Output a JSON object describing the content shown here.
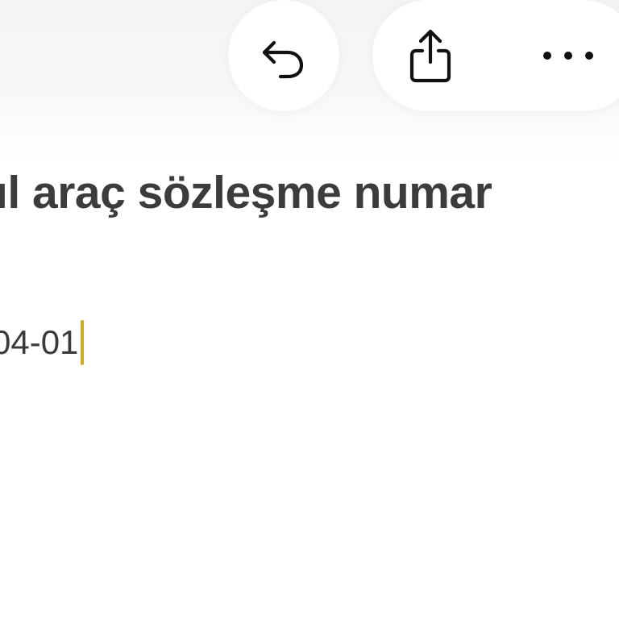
{
  "toolbar": {
    "undo_icon": "undo-arrow-icon",
    "share_icon": "share-icon",
    "more_icon": "ellipsis-icon"
  },
  "note": {
    "title": "ıl araç sözleşme numar",
    "body": "04-01"
  },
  "colors": {
    "caret": "#d4a72c",
    "title_text": "#3c3c3c",
    "body_text": "#3a3a3a",
    "toolbar_background": "#f4f4f4"
  }
}
